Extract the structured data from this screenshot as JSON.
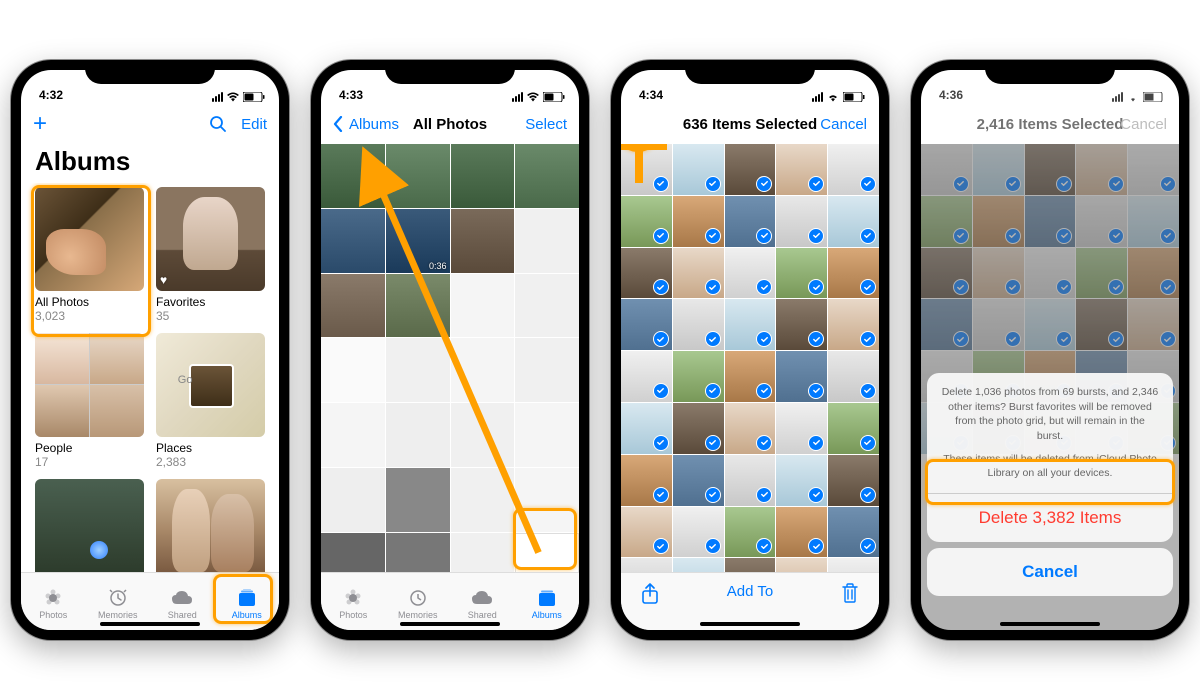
{
  "screens": [
    {
      "time": "4:32",
      "nav": {
        "add": "+",
        "search": "search-icon",
        "edit": "Edit"
      },
      "title": "Albums",
      "albums": [
        {
          "name": "All Photos",
          "count": "3,023"
        },
        {
          "name": "Favorites",
          "count": "35"
        },
        {
          "name": "People",
          "count": "17"
        },
        {
          "name": "Places",
          "count": "2,383"
        }
      ],
      "tabs": [
        "Photos",
        "Memories",
        "Shared",
        "Albums"
      ],
      "active_tab": 3
    },
    {
      "time": "4:33",
      "nav": {
        "back": "Albums",
        "title": "All Photos",
        "right": "Select"
      },
      "video_duration": "0:36",
      "tabs": [
        "Photos",
        "Memories",
        "Shared",
        "Albums"
      ],
      "active_tab": 3
    },
    {
      "time": "4:34",
      "nav": {
        "title": "636 Items Selected",
        "right": "Cancel"
      },
      "toolbar": {
        "share": "share-icon",
        "center": "Add To",
        "trash": "trash-icon"
      }
    },
    {
      "time": "4:36",
      "nav": {
        "title": "2,416 Items Selected",
        "right": "Cancel"
      },
      "sheet": {
        "msg1": "Delete 1,036 photos from 69 bursts, and 2,346 other items? Burst favorites will be removed from the photo grid, but will remain in the burst.",
        "msg2": "These items will be deleted from iCloud Photo Library on all your devices.",
        "delete": "Delete 3,382 Items",
        "cancel": "Cancel"
      }
    }
  ],
  "colors": {
    "tint": "#007aff",
    "highlight": "#ffa000",
    "destructive": "#ff3b30"
  }
}
